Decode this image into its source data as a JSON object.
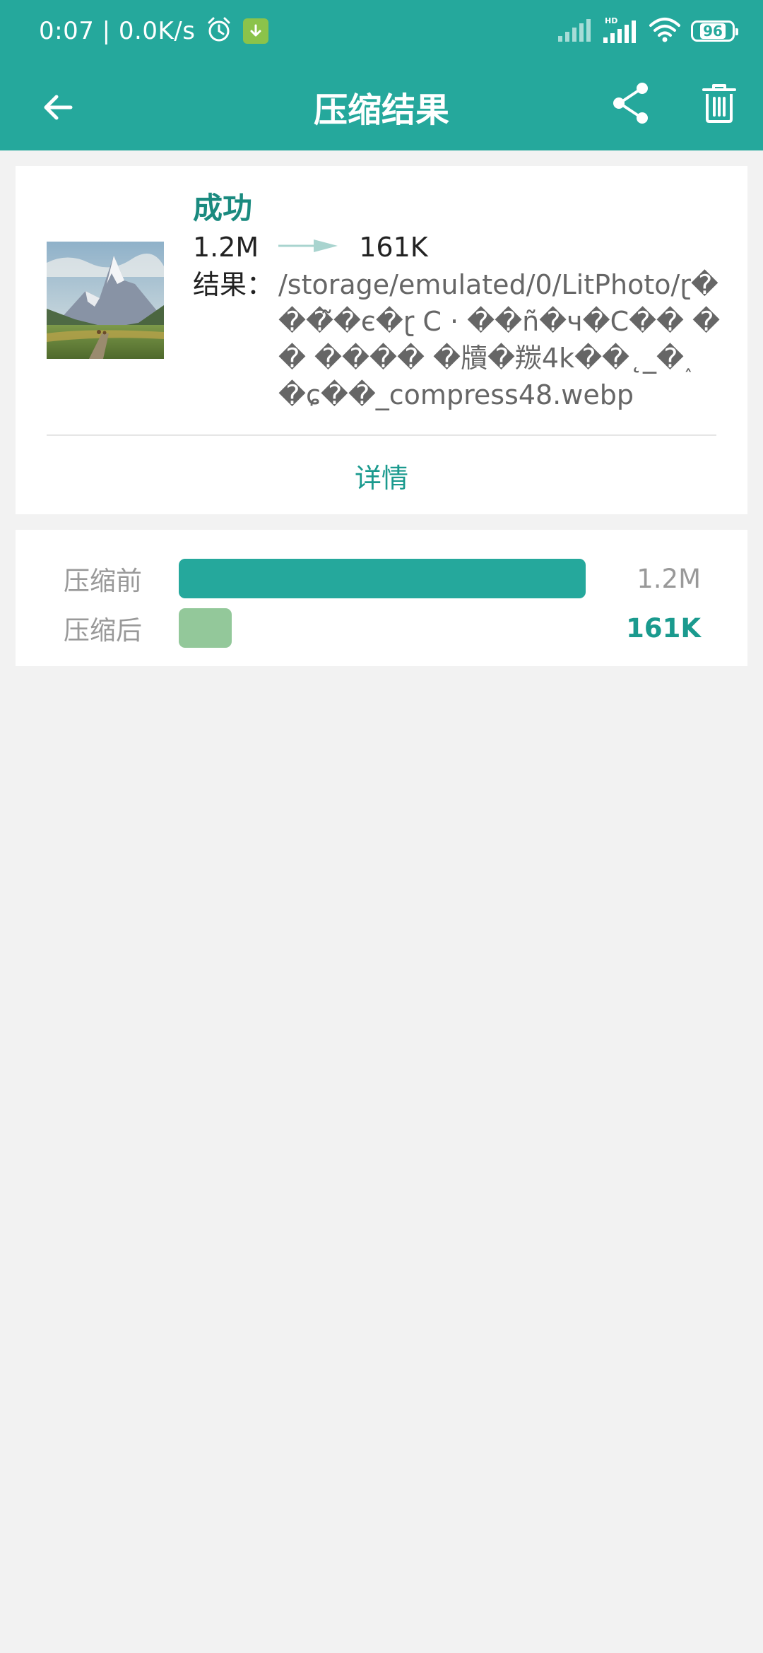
{
  "status_bar": {
    "time_speed": "0:07 | 0.0K/s",
    "battery": "96"
  },
  "app_bar": {
    "title": "压缩结果"
  },
  "result": {
    "status": "成功",
    "size_before": "1.2M",
    "size_after": "161K",
    "result_label": "结果：",
    "path": "/storage/emulated/0/LitPhoto/ɽ���̃�є�ɽ C · ��ñ�ч�C�� �� ���� �牘�羰4k��˛_�˰ �ɕ��_compress48.webp",
    "details_label": "详情"
  },
  "comparison": {
    "before_label": "压缩前",
    "before_value": "1.2M",
    "before_ratio": 1.0,
    "after_label": "压缩后",
    "after_value": "161K",
    "after_ratio": 0.131
  },
  "colors": {
    "primary": "#25a89c",
    "accent_text": "#1a9a8e",
    "after_bar": "#93c89a",
    "background": "#f2f2f2"
  },
  "icons": {
    "back": "arrow-left-icon",
    "share": "share-icon",
    "delete": "trash-icon",
    "alarm": "alarm-clock-icon",
    "download": "download-icon",
    "signal": "cell-signal-icon",
    "wifi": "wifi-icon",
    "battery": "battery-icon"
  }
}
